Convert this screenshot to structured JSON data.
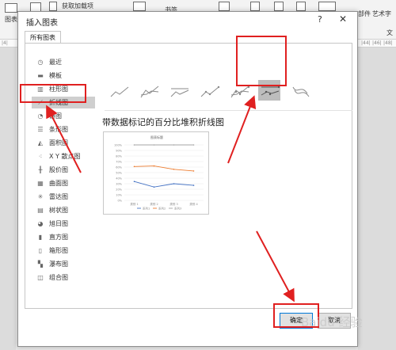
{
  "ribbon": {
    "chart_label": "图表",
    "get_addins": "获取加载项",
    "bookmark": "书签",
    "component": "部件",
    "art_text": "艺术字",
    "text": "文"
  },
  "ruler": {
    "left": "|4|",
    "marks": [
      "|44|",
      "|46|",
      "|48|"
    ]
  },
  "dialog": {
    "title": "插入图表",
    "help": "?",
    "close": "✕",
    "tab": "所有图表",
    "selected_heading": "带数据标记的百分比堆积折线图",
    "ok": "确定",
    "cancel": "取消"
  },
  "categories": [
    {
      "label": "最近",
      "icon": "recent-icon"
    },
    {
      "label": "模板",
      "icon": "folder-icon"
    },
    {
      "label": "柱形图",
      "icon": "column-chart-icon"
    },
    {
      "label": "折线图",
      "icon": "line-chart-icon",
      "selected": true
    },
    {
      "label": "饼图",
      "icon": "pie-chart-icon"
    },
    {
      "label": "条形图",
      "icon": "bar-chart-icon"
    },
    {
      "label": "面积图",
      "icon": "area-chart-icon"
    },
    {
      "label": "X Y 散点图",
      "icon": "scatter-chart-icon"
    },
    {
      "label": "股价图",
      "icon": "stock-chart-icon"
    },
    {
      "label": "曲面图",
      "icon": "surface-chart-icon"
    },
    {
      "label": "雷达图",
      "icon": "radar-chart-icon"
    },
    {
      "label": "树状图",
      "icon": "treemap-chart-icon"
    },
    {
      "label": "旭日图",
      "icon": "sunburst-chart-icon"
    },
    {
      "label": "直方图",
      "icon": "histogram-chart-icon"
    },
    {
      "label": "箱形图",
      "icon": "boxplot-chart-icon"
    },
    {
      "label": "瀑布图",
      "icon": "waterfall-chart-icon"
    },
    {
      "label": "组合图",
      "icon": "combo-chart-icon"
    }
  ],
  "subtypes": [
    {
      "name": "line",
      "selected": false
    },
    {
      "name": "stacked-line",
      "selected": false
    },
    {
      "name": "percent-stacked-line",
      "selected": false
    },
    {
      "name": "line-with-markers",
      "selected": false
    },
    {
      "name": "stacked-line-with-markers",
      "selected": false
    },
    {
      "name": "percent-stacked-line-with-markers",
      "selected": true
    },
    {
      "name": "3d-line",
      "selected": false
    }
  ],
  "preview": {
    "title": "图表标题",
    "yticks": [
      "100%",
      "90%",
      "80%",
      "70%",
      "60%",
      "50%",
      "40%",
      "30%",
      "20%",
      "10%",
      "0%"
    ],
    "categories": [
      "类别 1",
      "类别 2",
      "类别 3",
      "类别 4"
    ],
    "legend": [
      "系列1",
      "系列2",
      "系列3"
    ]
  },
  "chart_data": {
    "type": "line",
    "title": "图表标题",
    "categories": [
      "类别 1",
      "类别 2",
      "类别 3",
      "类别 4"
    ],
    "ylim": [
      0,
      100
    ],
    "series": [
      {
        "name": "系列1",
        "values": [
          34,
          24,
          30,
          27
        ]
      },
      {
        "name": "系列2",
        "values": [
          61,
          62,
          56,
          53
        ]
      },
      {
        "name": "系列3",
        "values": [
          100,
          100,
          100,
          100
        ]
      }
    ]
  },
  "colors": {
    "series1": "#4472c4",
    "series2": "#ed7d31",
    "series3": "#a5a5a5",
    "annotation": "#e02020",
    "selected_bg": "#cfcfcf"
  },
  "watermark": "Baidu 经验"
}
